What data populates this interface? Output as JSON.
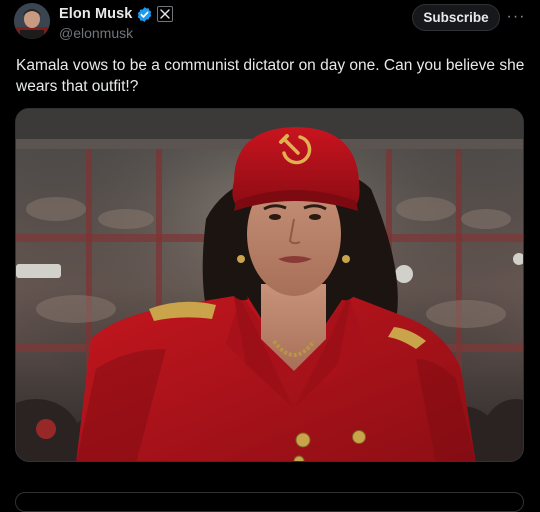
{
  "post": {
    "author": {
      "display_name": "Elon Musk",
      "handle": "@elonmusk",
      "verified_icon": "verified-badge-icon",
      "affiliate_icon": "x-logo-icon"
    },
    "actions": {
      "subscribe_label": "Subscribe",
      "more_icon": "more-options-icon",
      "more_glyph": "···"
    },
    "text": "Kamala vows to be a communist dictator on day one. Can you believe she wears that outfit!?",
    "media": {
      "type": "image",
      "hat_emblem_icon": "hammer-and-sickle-icon"
    }
  },
  "colors": {
    "background": "#000000",
    "text_primary": "#e7e9ea",
    "text_secondary": "#71767b",
    "verified_blue": "#1d9bf0",
    "border": "#2f3336",
    "coat_red": "#b3141d"
  }
}
